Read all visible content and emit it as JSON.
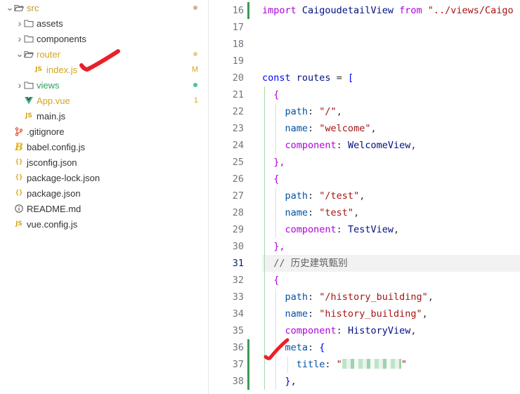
{
  "explorer": {
    "items": [
      {
        "id": "src",
        "label": "src",
        "kind": "folder-open",
        "depth": 0,
        "color": "#c09a2a",
        "status": "dot",
        "status_color": "#c8b98a"
      },
      {
        "id": "assets",
        "label": "assets",
        "kind": "folder",
        "depth": 1
      },
      {
        "id": "components",
        "label": "components",
        "kind": "folder",
        "depth": 1
      },
      {
        "id": "router",
        "label": "router",
        "kind": "folder-open",
        "depth": 1,
        "color": "#d6a51c",
        "status": "dot",
        "status_color": "#e5cf8a"
      },
      {
        "id": "index-js",
        "label": "index.js",
        "kind": "js",
        "depth": 2,
        "color": "#d6a51c",
        "status": "M",
        "status_color": "#d6a51c"
      },
      {
        "id": "views",
        "label": "views",
        "kind": "folder",
        "depth": 1,
        "color": "#2f9e5b",
        "status": "dot",
        "status_color": "#4fc28a"
      },
      {
        "id": "app-vue",
        "label": "App.vue",
        "kind": "vue",
        "depth": 1,
        "color": "#d6a51c",
        "status": "1",
        "status_color": "#d6a51c"
      },
      {
        "id": "main-js",
        "label": "main.js",
        "kind": "js",
        "depth": 1
      },
      {
        "id": "gitignore",
        "label": ".gitignore",
        "kind": "git",
        "depth": 0
      },
      {
        "id": "babel-config",
        "label": "babel.config.js",
        "kind": "babel",
        "depth": 0
      },
      {
        "id": "jsconfig",
        "label": "jsconfig.json",
        "kind": "json",
        "depth": 0
      },
      {
        "id": "package-lock",
        "label": "package-lock.json",
        "kind": "json",
        "depth": 0
      },
      {
        "id": "package-json",
        "label": "package.json",
        "kind": "json",
        "depth": 0
      },
      {
        "id": "readme",
        "label": "README.md",
        "kind": "info",
        "depth": 0
      },
      {
        "id": "vue-config",
        "label": "vue.config.js",
        "kind": "js",
        "depth": 0
      }
    ]
  },
  "editor": {
    "lines": [
      {
        "n": "16",
        "tokens": [
          {
            "t": "import ",
            "c": "kw2"
          },
          {
            "t": "CaigoudetailView ",
            "c": "var"
          },
          {
            "t": "from ",
            "c": "kw2"
          },
          {
            "t": "\"../views/Caigo",
            "c": "str"
          }
        ]
      },
      {
        "n": "17",
        "tokens": []
      },
      {
        "n": "18",
        "tokens": []
      },
      {
        "n": "19",
        "tokens": []
      },
      {
        "n": "20",
        "tokens": [
          {
            "t": "const ",
            "c": "kw"
          },
          {
            "t": "routes",
            "c": "var"
          },
          {
            "t": " = ",
            "c": "pun"
          },
          {
            "t": "[",
            "c": "kw"
          }
        ]
      },
      {
        "n": "21",
        "tokens": [
          {
            "t": "  {",
            "c": "kw2"
          }
        ]
      },
      {
        "n": "22",
        "tokens": [
          {
            "t": "    path",
            "c": "prop"
          },
          {
            "t": ": ",
            "c": "pun"
          },
          {
            "t": "\"/\"",
            "c": "str"
          },
          {
            "t": ",",
            "c": "pun"
          }
        ]
      },
      {
        "n": "23",
        "tokens": [
          {
            "t": "    name",
            "c": "prop"
          },
          {
            "t": ": ",
            "c": "pun"
          },
          {
            "t": "\"welcome\"",
            "c": "str"
          },
          {
            "t": ",",
            "c": "pun"
          }
        ]
      },
      {
        "n": "24",
        "tokens": [
          {
            "t": "    component",
            "c": "propc"
          },
          {
            "t": ": ",
            "c": "pun"
          },
          {
            "t": "WelcomeView",
            "c": "var"
          },
          {
            "t": ",",
            "c": "pun"
          }
        ]
      },
      {
        "n": "25",
        "tokens": [
          {
            "t": "  },",
            "c": "kw2"
          }
        ]
      },
      {
        "n": "26",
        "tokens": [
          {
            "t": "  {",
            "c": "kw2"
          }
        ]
      },
      {
        "n": "27",
        "tokens": [
          {
            "t": "    path",
            "c": "prop"
          },
          {
            "t": ": ",
            "c": "pun"
          },
          {
            "t": "\"/test\"",
            "c": "str"
          },
          {
            "t": ",",
            "c": "pun"
          }
        ]
      },
      {
        "n": "28",
        "tokens": [
          {
            "t": "    name",
            "c": "prop"
          },
          {
            "t": ": ",
            "c": "pun"
          },
          {
            "t": "\"test\"",
            "c": "str"
          },
          {
            "t": ",",
            "c": "pun"
          }
        ]
      },
      {
        "n": "29",
        "tokens": [
          {
            "t": "    component",
            "c": "propc"
          },
          {
            "t": ": ",
            "c": "pun"
          },
          {
            "t": "TestView",
            "c": "var"
          },
          {
            "t": ",",
            "c": "pun"
          }
        ]
      },
      {
        "n": "30",
        "tokens": [
          {
            "t": "  },",
            "c": "kw2"
          }
        ]
      },
      {
        "n": "31",
        "tokens": [
          {
            "t": "  // 历史建筑甄别",
            "c": "cmt"
          }
        ],
        "current": true
      },
      {
        "n": "32",
        "tokens": [
          {
            "t": "  {",
            "c": "kw2"
          }
        ]
      },
      {
        "n": "33",
        "tokens": [
          {
            "t": "    path",
            "c": "prop"
          },
          {
            "t": ": ",
            "c": "pun"
          },
          {
            "t": "\"/history_building\"",
            "c": "str"
          },
          {
            "t": ",",
            "c": "pun"
          }
        ]
      },
      {
        "n": "34",
        "tokens": [
          {
            "t": "    name",
            "c": "prop"
          },
          {
            "t": ": ",
            "c": "pun"
          },
          {
            "t": "\"history_building\"",
            "c": "str"
          },
          {
            "t": ",",
            "c": "pun"
          }
        ]
      },
      {
        "n": "35",
        "tokens": [
          {
            "t": "    component",
            "c": "propc"
          },
          {
            "t": ": ",
            "c": "pun"
          },
          {
            "t": "HistoryView",
            "c": "var"
          },
          {
            "t": ",",
            "c": "pun"
          }
        ]
      },
      {
        "n": "36",
        "tokens": [
          {
            "t": "    meta",
            "c": "prop"
          },
          {
            "t": ": ",
            "c": "pun"
          },
          {
            "t": "{",
            "c": "kw"
          }
        ]
      },
      {
        "n": "37",
        "tokens": [
          {
            "t": "      title",
            "c": "prop"
          },
          {
            "t": ": ",
            "c": "pun"
          },
          {
            "t": "\"",
            "c": "str"
          },
          {
            "t": "",
            "c": "blur"
          },
          {
            "t": "\"",
            "c": "str"
          }
        ]
      },
      {
        "n": "38",
        "tokens": [
          {
            "t": "    },",
            "c": "kw"
          }
        ]
      }
    ]
  },
  "colors": {
    "accent_modified": "#3a9a55",
    "annotation_red": "#e8202a"
  }
}
